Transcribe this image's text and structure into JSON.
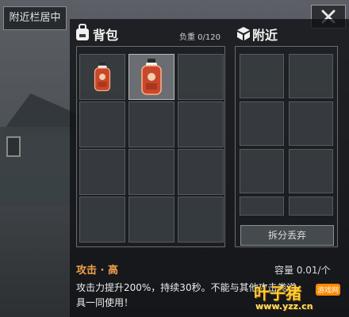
{
  "top_tab": {
    "label": "附近栏居中"
  },
  "close_icon_name": "close-icon",
  "backpack": {
    "title": "背包",
    "weight_text": "负重 0/120",
    "icon": "backpack-icon",
    "items": [
      {
        "name": "stimulant-bottle",
        "selected": false
      },
      {
        "name": "stimulant-bottle",
        "selected": true
      }
    ]
  },
  "nearby": {
    "title": "附近",
    "icon": "box-icon",
    "split_discard_label": "拆分丢弃"
  },
  "item_info": {
    "title": "攻击 · 高",
    "capacity_text": "容量 0.01/个",
    "description": "攻击力提升200%，持续30秒。不能与其他攻击类道\n具一同使用！"
  },
  "watermark": {
    "main": "叶子猪",
    "tag": "游戏网",
    "url": "www.yzz.cn"
  },
  "colors": {
    "accent_orange": "#f0a04c",
    "panel_bg": "#0e1013"
  }
}
